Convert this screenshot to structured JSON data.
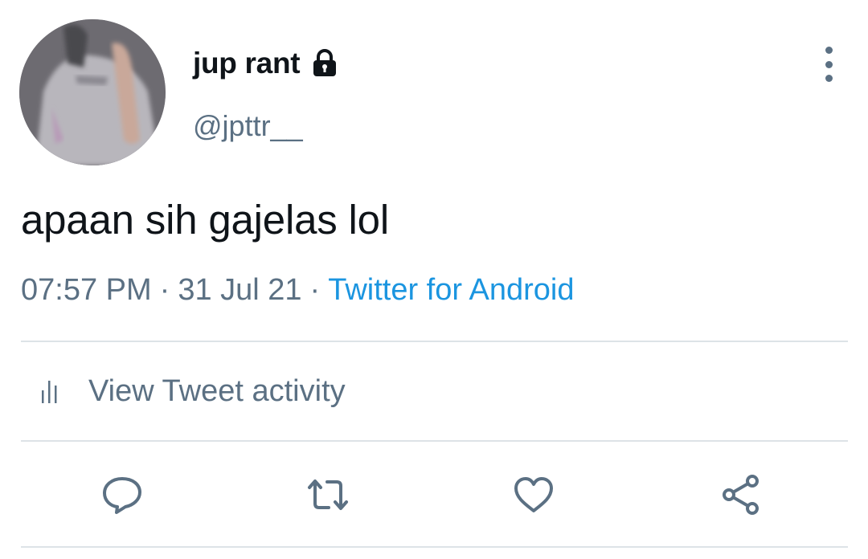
{
  "tweet": {
    "author": {
      "display_name": "jup rant",
      "handle": "@jpttr__",
      "protected_icon": "lock-icon",
      "avatar": "avatar-photo"
    },
    "text": "apaan sih gajelas lol",
    "meta": {
      "time": "07:57 PM",
      "separator": "·",
      "date": "31 Jul 21",
      "source": "Twitter for Android"
    },
    "activity_label": "View Tweet activity",
    "actions": [
      {
        "name": "reply",
        "icon": "reply-icon"
      },
      {
        "name": "retweet",
        "icon": "retweet-icon"
      },
      {
        "name": "like",
        "icon": "heart-icon"
      },
      {
        "name": "share",
        "icon": "share-icon"
      }
    ],
    "more_icon": "more-vertical-icon"
  },
  "colors": {
    "text_primary": "#0f1419",
    "text_secondary": "#5b7083",
    "link": "#1b95e0",
    "divider": "#dde3e7"
  }
}
